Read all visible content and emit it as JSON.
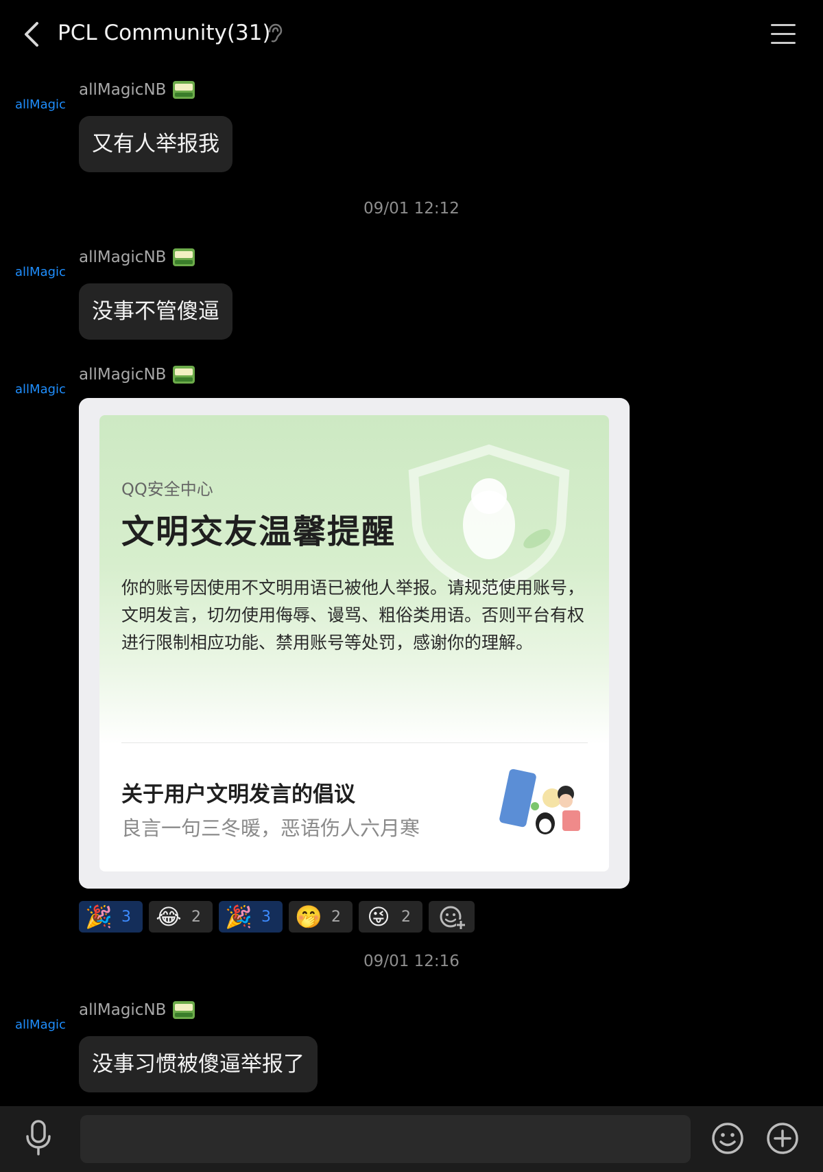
{
  "header": {
    "title": "PCL Community(31)",
    "back_icon": "chevron-left-icon",
    "menu_icon": "hamburger-menu-icon",
    "ear_icon": "ear-icon"
  },
  "messages": [
    {
      "avatar_text": "allMagic",
      "sender": "allMagicNB",
      "text": "又有人举报我"
    },
    {
      "avatar_text": "allMagic",
      "sender": "allMagicNB",
      "text": "没事不管傻逼"
    },
    {
      "avatar_text": "allMagic",
      "sender": "allMagicNB"
    },
    {
      "avatar_text": "allMagic",
      "sender": "allMagicNB",
      "text": "没事习惯被傻逼举报了"
    }
  ],
  "timestamps": [
    "09/01 12:12",
    "09/01 12:16"
  ],
  "card": {
    "source": "QQ安全中心",
    "heading": "文明交友温馨提醒",
    "body": "你的账号因使用不文明用语已被他人举报。请规范使用账号，文明发言，切勿使用侮辱、谩骂、粗俗类用语。否则平台有权进行限制相应功能、禁用账号等处罚，感谢你的理解。",
    "link_title": "关于用户文明发言的倡议",
    "link_subtitle": "良言一句三冬暖，恶语伤人六月寒"
  },
  "reactions": [
    {
      "emoji": "🎉",
      "count": "3",
      "selected": true
    },
    {
      "emoji": "😂",
      "count": "2",
      "selected": false
    },
    {
      "emoji": "🎉",
      "count": "3",
      "selected": true
    },
    {
      "emoji": "🤭",
      "count": "2",
      "selected": false
    },
    {
      "emoji": "😜",
      "count": "2",
      "selected": false
    }
  ],
  "input_bar": {
    "mic_icon": "microphone-icon",
    "emoji_icon": "smiley-icon",
    "plus_icon": "plus-circle-icon"
  },
  "colors": {
    "background": "#000000",
    "bubble": "#242424",
    "avatar_text": "#1f8fff",
    "reaction_selected": "#142e5a",
    "reaction_count_selected": "#3d8bff"
  }
}
